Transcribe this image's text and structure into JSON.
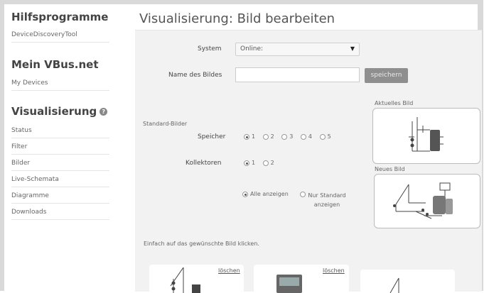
{
  "sidebar": {
    "heading1": "Hilfsprogramme",
    "tools": [
      "DeviceDiscoveryTool"
    ],
    "heading2": "Mein VBus.net",
    "my": [
      "My Devices"
    ],
    "heading3": "Visualisierung",
    "help_icon": "question-circle-icon",
    "vis_items": [
      "Status",
      "Filter",
      "Bilder",
      "Live-Schemata",
      "Diagramme",
      "Downloads"
    ]
  },
  "main": {
    "title": "Visualisierung: Bild bearbeiten",
    "system_label": "System",
    "system_value": "Online:",
    "name_label": "Name des Bildes",
    "name_value": "",
    "save_label": "speichern",
    "standard_label": "Standard-Bilder",
    "speicher_label": "Speicher",
    "speicher_options": [
      "1",
      "2",
      "3",
      "4",
      "5"
    ],
    "kollektoren_label": "Kollektoren",
    "kollektoren_options": [
      "1",
      "2"
    ],
    "show_all_label": "Alle anzeigen",
    "show_std_label_1": "Nur Standard",
    "show_std_label_2": "anzeigen",
    "current_image_label": "Aktuelles Bild",
    "new_image_label": "Neues Bild",
    "hint": "Einfach auf das gewünschte Bild klicken.",
    "delete_label": "löschen"
  }
}
